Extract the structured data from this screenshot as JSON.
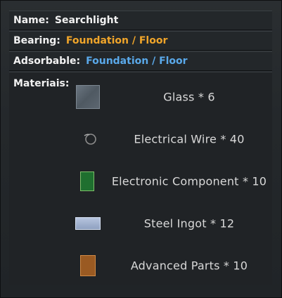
{
  "tooltip": {
    "name": {
      "label": "Name:",
      "value": "Searchlight"
    },
    "bearing": {
      "label": "Bearing:",
      "value": "Foundation / Floor"
    },
    "adsorbable": {
      "label": "Adsorbable:",
      "value": "Foundation / Floor"
    },
    "materials_label": "Materiais:",
    "materials": [
      {
        "icon": "glass-icon",
        "text": "Glass * 6"
      },
      {
        "icon": "electrical-wire-icon",
        "text": "Electrical Wire * 40"
      },
      {
        "icon": "electronic-component-icon",
        "text": "Electronic Component * 10"
      },
      {
        "icon": "steel-ingot-icon",
        "text": "Steel Ingot * 12"
      },
      {
        "icon": "advanced-parts-icon",
        "text": "Advanced Parts * 10"
      }
    ]
  },
  "colors": {
    "accent_orange": "#f0a52a",
    "accent_blue": "#5aa9ea",
    "text": "#f1f1f1",
    "material_text": "#d9d9d9"
  }
}
